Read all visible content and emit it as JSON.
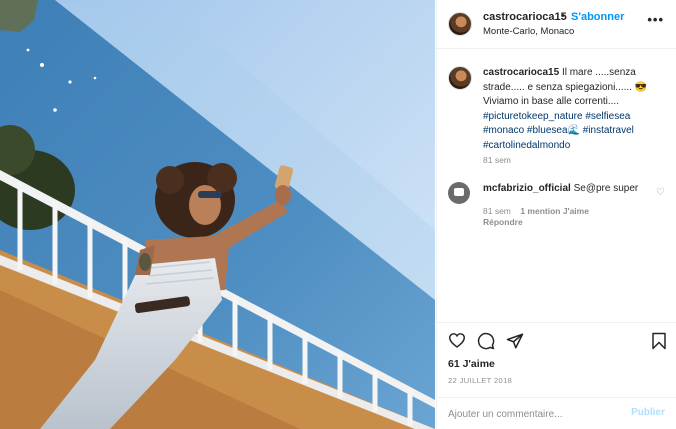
{
  "post": {
    "username": "castrocarioca15",
    "separator": "•",
    "follow_label": "S'abonner",
    "location": "Monte-Carlo, Monaco",
    "more_icon": "more-horizontal-icon"
  },
  "caption": {
    "username": "castrocarioca15",
    "text_line1": " Il mare .....senza",
    "text_line2": "strade..... e senza spiegazioni...... 😎",
    "text_line3": "Viviamo in base alle correnti....",
    "hashtags": [
      "#picturetokeep_nature",
      "#selfiesea",
      "#monaco",
      "#bluesea🌊",
      "#instatravel",
      "#cartolinedalmondo"
    ],
    "time": "81 sem"
  },
  "comment": {
    "username": "mcfabrizio_official",
    "text": "Se@pre super",
    "time": "81 sem",
    "mentions": "1 mention J'aime",
    "reply": "Répondre"
  },
  "actions": {
    "like_icon": "heart-icon",
    "comment_icon": "comment-icon",
    "share_icon": "share-icon",
    "save_icon": "bookmark-icon",
    "likes": "61 J'aime",
    "date": "22 JUILLET 2018"
  },
  "add_comment": {
    "placeholder": "Ajouter un commentaire...",
    "post_label": "Publier"
  },
  "colors": {
    "accent": "#0095f6",
    "hashtag": "#00376b",
    "muted": "#8e8e8e",
    "post_disabled": "#b2dffc"
  }
}
